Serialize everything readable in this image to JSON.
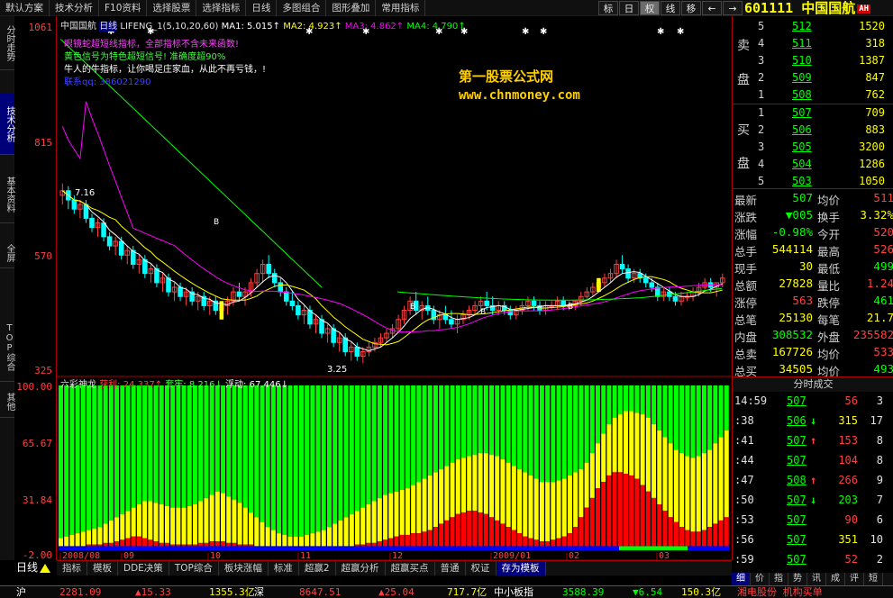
{
  "menu": {
    "items": [
      "默认方案",
      "技术分析",
      "F10资料",
      "选择股票",
      "选择指标",
      "日线",
      "多图组合",
      "图形叠加",
      "常用指标"
    ],
    "tools": [
      "标",
      "日",
      "权",
      "线",
      "移",
      "←",
      "→"
    ],
    "stock_code": "601111",
    "stock_name": "中国国航",
    "badge": "AH"
  },
  "left_tabs": [
    "分时走势",
    "技术分析",
    "基本资料",
    "全屏",
    "TOP综合",
    "其他"
  ],
  "yaxis": {
    "price": [
      "1061",
      "815",
      "570",
      "325"
    ],
    "indicator": [
      "100.00",
      "65.67",
      "31.84",
      "-2.00"
    ]
  },
  "main_legend": {
    "name": "中国国航",
    "period": "日线",
    "indicator": "LIFENG_1(5,10,20,60)",
    "ma1": "MA1: 5.015↑",
    "ma2": "MA2: 4.923↑",
    "ma3": "MA3: 4.862↑",
    "ma4": "MA4: 4.790↑"
  },
  "info_lines": [
    "眼镜蛇超短线指标，全部指标不含未来函数!",
    "黄色信号为特色超短信号! 准确度超90%",
    "牛人的牛指标，让你喝足庄家血，从此不再亏钱，!",
    "联系qq: 386021290"
  ],
  "watermark": {
    "title": "第一股票公式网",
    "url": "www.chnmoney.com"
  },
  "annotations": {
    "high_price": "7.16",
    "low_price": "3.25",
    "buy_mark": "B"
  },
  "sub_legend": {
    "name": "六彩神龙",
    "trend": "获利: 24.337↑",
    "lock": "套牢: 8.216↓",
    "float": "浮动: 67.446↓"
  },
  "chart_data": {
    "type": "bar",
    "x_axis": [
      "2008/08",
      "09",
      "10",
      "11",
      "12",
      "2009/01",
      "02",
      "03"
    ],
    "price_candles": [
      [
        6.9,
        7.16,
        6.7,
        7.0
      ],
      [
        7.0,
        7.1,
        6.6,
        6.8
      ],
      [
        6.8,
        6.9,
        6.5,
        6.6
      ],
      [
        6.6,
        6.8,
        6.4,
        6.7
      ],
      [
        6.7,
        6.8,
        6.3,
        6.4
      ],
      [
        6.4,
        6.5,
        6.1,
        6.2
      ],
      [
        6.2,
        6.4,
        6.0,
        6.3
      ],
      [
        6.3,
        6.4,
        5.9,
        6.0
      ],
      [
        6.0,
        6.1,
        5.7,
        5.8
      ],
      [
        5.8,
        6.0,
        5.6,
        5.9
      ],
      [
        5.9,
        6.0,
        5.5,
        5.6
      ],
      [
        5.6,
        5.8,
        5.4,
        5.7
      ],
      [
        5.7,
        5.8,
        5.3,
        5.4
      ],
      [
        5.4,
        5.6,
        5.2,
        5.5
      ],
      [
        5.5,
        5.6,
        5.1,
        5.2
      ],
      [
        5.2,
        5.4,
        5.0,
        5.3
      ],
      [
        5.3,
        5.4,
        4.9,
        5.0
      ],
      [
        5.0,
        5.2,
        4.8,
        5.1
      ],
      [
        5.1,
        5.2,
        4.7,
        4.8
      ],
      [
        4.8,
        5.0,
        4.6,
        4.9
      ],
      [
        4.9,
        5.0,
        4.6,
        4.7
      ],
      [
        4.7,
        4.9,
        4.5,
        4.8
      ],
      [
        4.8,
        4.9,
        4.5,
        4.6
      ],
      [
        4.6,
        4.8,
        4.4,
        4.7
      ],
      [
        4.7,
        4.8,
        4.4,
        4.5
      ],
      [
        4.5,
        4.7,
        4.3,
        4.6
      ],
      [
        4.6,
        4.7,
        4.3,
        4.4
      ],
      [
        4.4,
        4.6,
        4.2,
        4.5
      ],
      [
        4.5,
        4.7,
        4.3,
        4.6
      ],
      [
        4.6,
        4.9,
        4.5,
        4.8
      ],
      [
        4.8,
        5.0,
        4.6,
        4.7
      ],
      [
        4.7,
        4.9,
        4.5,
        4.8
      ],
      [
        4.8,
        5.1,
        4.7,
        5.0
      ],
      [
        5.0,
        5.3,
        4.9,
        5.2
      ],
      [
        5.2,
        5.5,
        5.0,
        5.4
      ],
      [
        5.4,
        5.6,
        5.1,
        5.2
      ],
      [
        5.2,
        5.3,
        4.9,
        5.0
      ],
      [
        5.0,
        5.1,
        4.7,
        4.8
      ],
      [
        4.8,
        4.9,
        4.5,
        4.6
      ],
      [
        4.6,
        4.8,
        4.4,
        4.5
      ],
      [
        4.5,
        4.6,
        4.2,
        4.3
      ],
      [
        4.3,
        4.5,
        4.1,
        4.4
      ],
      [
        4.4,
        4.5,
        4.0,
        4.1
      ],
      [
        4.1,
        4.3,
        3.9,
        4.2
      ],
      [
        4.2,
        4.3,
        3.8,
        3.9
      ],
      [
        3.9,
        4.1,
        3.7,
        4.0
      ],
      [
        4.0,
        4.1,
        3.6,
        3.7
      ],
      [
        3.7,
        3.9,
        3.5,
        3.8
      ],
      [
        3.8,
        3.9,
        3.4,
        3.5
      ],
      [
        3.5,
        3.7,
        3.3,
        3.6
      ],
      [
        3.6,
        3.7,
        3.3,
        3.4
      ],
      [
        3.4,
        3.6,
        3.25,
        3.5
      ],
      [
        3.5,
        3.7,
        3.4,
        3.6
      ],
      [
        3.6,
        3.8,
        3.5,
        3.7
      ],
      [
        3.7,
        3.9,
        3.6,
        3.8
      ],
      [
        3.8,
        4.0,
        3.7,
        3.9
      ],
      [
        3.9,
        4.1,
        3.8,
        4.0
      ],
      [
        4.0,
        4.3,
        3.9,
        4.2
      ],
      [
        4.2,
        4.5,
        4.1,
        4.4
      ],
      [
        4.4,
        4.7,
        4.3,
        4.6
      ],
      [
        4.6,
        4.8,
        4.3,
        4.4
      ],
      [
        4.4,
        4.6,
        4.2,
        4.5
      ],
      [
        4.5,
        4.7,
        4.3,
        4.4
      ],
      [
        4.4,
        4.5,
        4.1,
        4.2
      ],
      [
        4.2,
        4.4,
        4.0,
        4.3
      ],
      [
        4.3,
        4.5,
        4.1,
        4.2
      ],
      [
        4.2,
        4.4,
        4.0,
        4.1
      ],
      [
        4.1,
        4.3,
        3.9,
        4.2
      ],
      [
        4.2,
        4.4,
        4.1,
        4.3
      ],
      [
        4.3,
        4.5,
        4.2,
        4.4
      ],
      [
        4.4,
        4.6,
        4.3,
        4.5
      ],
      [
        4.5,
        4.7,
        4.4,
        4.6
      ],
      [
        4.6,
        4.8,
        4.4,
        4.5
      ],
      [
        4.5,
        4.7,
        4.3,
        4.4
      ],
      [
        4.4,
        4.6,
        4.3,
        4.5
      ],
      [
        4.5,
        4.6,
        4.3,
        4.4
      ],
      [
        4.4,
        4.5,
        4.2,
        4.3
      ],
      [
        4.3,
        4.5,
        4.2,
        4.4
      ],
      [
        4.4,
        4.6,
        4.3,
        4.5
      ],
      [
        4.5,
        4.7,
        4.4,
        4.6
      ],
      [
        4.6,
        4.7,
        4.4,
        4.5
      ],
      [
        4.5,
        4.6,
        4.3,
        4.4
      ],
      [
        4.4,
        4.6,
        4.3,
        4.5
      ],
      [
        4.5,
        4.6,
        4.4,
        4.5
      ],
      [
        4.5,
        4.7,
        4.4,
        4.6
      ],
      [
        4.6,
        4.7,
        4.4,
        4.5
      ],
      [
        4.5,
        4.6,
        4.4,
        4.5
      ],
      [
        4.5,
        4.6,
        4.4,
        4.6
      ],
      [
        4.6,
        4.8,
        4.5,
        4.7
      ],
      [
        4.7,
        4.9,
        4.6,
        4.8
      ],
      [
        4.8,
        5.0,
        4.7,
        4.9
      ],
      [
        4.9,
        5.1,
        4.8,
        5.0
      ],
      [
        5.0,
        5.2,
        4.9,
        5.1
      ],
      [
        5.1,
        5.3,
        5.0,
        5.2
      ],
      [
        5.2,
        5.5,
        5.1,
        5.4
      ],
      [
        5.4,
        5.6,
        5.2,
        5.3
      ],
      [
        5.3,
        5.4,
        5.0,
        5.1
      ],
      [
        5.1,
        5.3,
        5.0,
        5.2
      ],
      [
        5.2,
        5.3,
        5.0,
        5.1
      ],
      [
        5.1,
        5.2,
        4.9,
        5.0
      ],
      [
        5.0,
        5.1,
        4.8,
        4.9
      ],
      [
        4.9,
        5.0,
        4.6,
        4.7
      ],
      [
        4.7,
        4.9,
        4.6,
        4.8
      ],
      [
        4.8,
        4.9,
        4.6,
        4.7
      ],
      [
        4.7,
        4.8,
        4.5,
        4.6
      ],
      [
        4.6,
        4.8,
        4.5,
        4.7
      ],
      [
        4.7,
        4.8,
        4.6,
        4.7
      ],
      [
        4.7,
        4.9,
        4.6,
        4.8
      ],
      [
        4.8,
        5.0,
        4.7,
        4.9
      ],
      [
        4.9,
        5.1,
        4.8,
        5.0
      ],
      [
        5.0,
        5.1,
        4.8,
        4.9
      ],
      [
        4.9,
        5.0,
        4.7,
        5.0
      ],
      [
        5.0,
        5.2,
        4.9,
        5.1
      ]
    ],
    "sub_index": {
      "type": "area",
      "series": [
        {
          "values": [
            5,
            6,
            7,
            8,
            9,
            10,
            11,
            12,
            14,
            16,
            18,
            20,
            22,
            24,
            26,
            28,
            28,
            27,
            26,
            25,
            24,
            24,
            24,
            25,
            26,
            28,
            30,
            32,
            34,
            33,
            31,
            29,
            27,
            24,
            21,
            18,
            15,
            12,
            10,
            8,
            7,
            6,
            6,
            6,
            7,
            8,
            9,
            10,
            12,
            14,
            16,
            18,
            20,
            22,
            24,
            26,
            28,
            30,
            32,
            33,
            34,
            35,
            36,
            38,
            40,
            42,
            44,
            46,
            48,
            50,
            52,
            54,
            55,
            56,
            57,
            58,
            58,
            57,
            56,
            54,
            52,
            50,
            48,
            46,
            44,
            42,
            40,
            40,
            40,
            41,
            42,
            44,
            46,
            48,
            52,
            58,
            64,
            70,
            76,
            80,
            82,
            84,
            84,
            83,
            82,
            80,
            76,
            72,
            68,
            64,
            60,
            58,
            56,
            55,
            56,
            58,
            60,
            64,
            68,
            72
          ]
        },
        {
          "values": [
            0,
            0,
            0,
            0,
            0,
            1,
            1,
            1,
            2,
            2,
            3,
            4,
            5,
            6,
            6,
            5,
            4,
            3,
            2,
            2,
            1,
            1,
            1,
            1,
            1,
            2,
            2,
            3,
            3,
            3,
            2,
            2,
            1,
            1,
            1,
            0,
            0,
            0,
            0,
            0,
            0,
            0,
            0,
            0,
            0,
            0,
            0,
            0,
            0,
            0,
            0,
            0,
            0,
            1,
            1,
            2,
            2,
            3,
            4,
            5,
            6,
            7,
            7,
            8,
            8,
            9,
            10,
            12,
            14,
            16,
            18,
            20,
            21,
            22,
            22,
            21,
            20,
            18,
            16,
            14,
            12,
            10,
            8,
            6,
            5,
            4,
            3,
            3,
            4,
            5,
            6,
            8,
            12,
            18,
            24,
            30,
            36,
            40,
            44,
            46,
            46,
            45,
            44,
            42,
            38,
            34,
            30,
            26,
            22,
            18,
            15,
            12,
            10,
            9,
            9,
            10,
            12,
            14,
            16,
            18
          ]
        }
      ]
    }
  },
  "orderbook": {
    "sell_label": [
      "卖",
      "盘"
    ],
    "buy_label": [
      "买",
      "盘"
    ],
    "sell": [
      {
        "lvl": "5",
        "price": "512",
        "vol": "1520"
      },
      {
        "lvl": "4",
        "price": "511",
        "vol": "318"
      },
      {
        "lvl": "3",
        "price": "510",
        "vol": "1387"
      },
      {
        "lvl": "2",
        "price": "509",
        "vol": "847"
      },
      {
        "lvl": "1",
        "price": "508",
        "vol": "762"
      }
    ],
    "buy": [
      {
        "lvl": "1",
        "price": "507",
        "vol": "709"
      },
      {
        "lvl": "2",
        "price": "506",
        "vol": "883"
      },
      {
        "lvl": "3",
        "price": "505",
        "vol": "3200"
      },
      {
        "lvl": "4",
        "price": "504",
        "vol": "1286"
      },
      {
        "lvl": "5",
        "price": "503",
        "vol": "1050"
      }
    ]
  },
  "stats": [
    {
      "l1": "最新",
      "v1": "507",
      "l2": "均价",
      "v2": "511",
      "c1": "#00ff00",
      "c2": "#ff4040"
    },
    {
      "l1": "涨跌",
      "v1": "▼005",
      "l2": "换手",
      "v2": "3.32%",
      "c1": "#00ff00",
      "c2": "#ffff00"
    },
    {
      "l1": "涨幅",
      "v1": "-0.98%",
      "l2": "今开",
      "v2": "520",
      "c1": "#00ff00",
      "c2": "#ff4040"
    },
    {
      "l1": "总手",
      "v1": "544114",
      "l2": "最高",
      "v2": "526",
      "c1": "#ffff00",
      "c2": "#ff4040"
    },
    {
      "l1": "现手",
      "v1": "30",
      "l2": "最低",
      "v2": "499",
      "c1": "#ffff00",
      "c2": "#00ff00"
    },
    {
      "l1": "总额",
      "v1": "27828",
      "l2": "量比",
      "v2": "1.24",
      "c1": "#ffff00",
      "c2": "#ff4040"
    },
    {
      "l1": "涨停",
      "v1": "563",
      "l2": "跌停",
      "v2": "461",
      "c1": "#ff4040",
      "c2": "#00ff00"
    },
    {
      "l1": "总笔",
      "v1": "25130",
      "l2": "每笔",
      "v2": "21.7",
      "c1": "#ffff00",
      "c2": "#ffff00"
    },
    {
      "l1": "内盘",
      "v1": "308532",
      "l2": "外盘",
      "v2": "235582",
      "c1": "#00ff00",
      "c2": "#ff4040"
    },
    {
      "l1": "总卖",
      "v1": "167726",
      "l2": "均价",
      "v2": "533",
      "c1": "#ffff00",
      "c2": "#ff4040"
    },
    {
      "l1": "总买",
      "v1": "34505",
      "l2": "均价",
      "v2": "493",
      "c1": "#ffff00",
      "c2": "#00ff00"
    }
  ],
  "trades_header": "分时成交",
  "trades": [
    {
      "time": "14:59",
      "price": "507",
      "vol": "56",
      "n": "3",
      "arrow": "",
      "vc": "#ff4040"
    },
    {
      "time": ":38",
      "price": "506",
      "vol": "315",
      "n": "17",
      "arrow": "↓",
      "vc": "#ffff00"
    },
    {
      "time": ":41",
      "price": "507",
      "vol": "153",
      "n": "8",
      "arrow": "↑",
      "vc": "#ff4040"
    },
    {
      "time": ":44",
      "price": "507",
      "vol": "104",
      "n": "8",
      "arrow": "",
      "vc": "#ff4040"
    },
    {
      "time": ":47",
      "price": "508",
      "vol": "266",
      "n": "9",
      "arrow": "↑",
      "vc": "#ff4040"
    },
    {
      "time": ":50",
      "price": "507",
      "vol": "203",
      "n": "7",
      "arrow": "↓",
      "vc": "#00ff00"
    },
    {
      "time": ":53",
      "price": "507",
      "vol": "90",
      "n": "6",
      "arrow": "",
      "vc": "#ff4040"
    },
    {
      "time": ":56",
      "price": "507",
      "vol": "351",
      "n": "10",
      "arrow": "",
      "vc": "#ffff00"
    },
    {
      "time": ":59",
      "price": "507",
      "vol": "52",
      "n": "2",
      "arrow": "",
      "vc": "#ff4040"
    },
    {
      "time": "15:00",
      "price": "507",
      "vol": "30",
      "n": "1",
      "arrow": "",
      "vc": "#ffff00"
    }
  ],
  "bottom_tabs": [
    "指标",
    "模板",
    "DDE决策",
    "TOP综合",
    "板块涨幅",
    "标准",
    "超赢2",
    "超赢分析",
    "超赢买点",
    "普通",
    "权证",
    "存为模板"
  ],
  "bottom_active": "存为模板",
  "period_label": "日线",
  "tick_tabs": [
    "细",
    "价",
    "指",
    "势",
    "讯",
    "成",
    "评",
    "短"
  ],
  "status": {
    "sh_label": "沪",
    "sh_index": "2281.09",
    "sh_change": "▲15.33",
    "sh_amount": "1355.3亿",
    "sz_label": "深",
    "sz_index": "8647.51",
    "sz_change": "▲25.04",
    "sz_amount": "717.7亿",
    "sme_label": "中小板指",
    "sme_index": "3588.39",
    "sme_change": "▼6.54",
    "sme_amount": "150.3亿",
    "ticker": "湘电股份 机构买单"
  },
  "colors": {
    "up": "#ff4040",
    "down": "#00ffff",
    "ma1": "#ffffff",
    "ma2": "#ffff00",
    "ma3": "#ff00ff",
    "ma4": "#00ff00",
    "axis": "#aa0000",
    "band_green": "#00ff00",
    "band_yellow": "#ffff00",
    "band_red": "#ff0000",
    "band_blue": "#0000ff"
  }
}
